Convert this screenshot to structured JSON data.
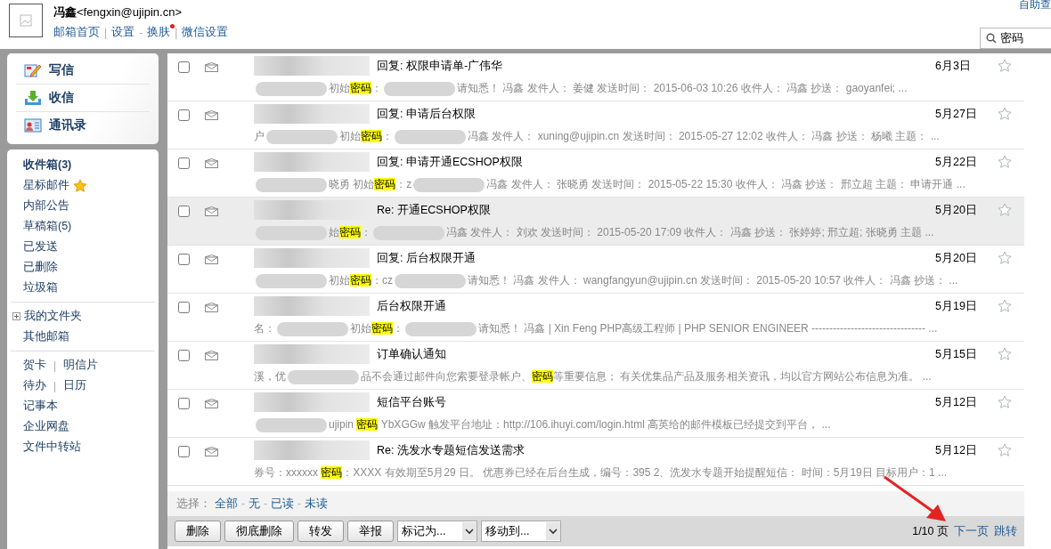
{
  "header": {
    "user": "**冯鑫**<fengxin@ujipin.cn>",
    "links": [
      {
        "label": "邮箱首页",
        "badge": false
      },
      {
        "label": "设置",
        "badge": false
      },
      {
        "label": "换肤",
        "badge": true
      },
      {
        "label": "微信设置",
        "badge": false
      }
    ],
    "separators": [
      "|",
      "-",
      "|"
    ],
    "help": "自助查",
    "search": {
      "value": "密码"
    }
  },
  "sidebar": {
    "actions": [
      {
        "label": "写信",
        "kind": "compose"
      },
      {
        "label": "收信",
        "kind": "receive"
      },
      {
        "label": "通讯录",
        "kind": "contacts"
      }
    ],
    "folders": [
      {
        "label": "收件箱(3)",
        "bold": true,
        "starred": false
      },
      {
        "label": "星标邮件",
        "bold": false,
        "starred": true
      },
      {
        "label": "内部公告",
        "bold": false,
        "starred": false
      },
      {
        "label": "草稿箱(5)",
        "bold": false,
        "starred": false
      },
      {
        "label": "已发送",
        "bold": false,
        "starred": false
      },
      {
        "label": "已删除",
        "bold": false,
        "starred": false
      },
      {
        "label": "垃圾箱",
        "bold": false,
        "starred": false
      }
    ],
    "my_folders": {
      "label": "我的文件夹",
      "expanded": false
    },
    "other": "其他邮箱",
    "tools": [
      {
        "items": [
          "贺卡",
          "明信片"
        ],
        "separator": "|"
      },
      {
        "items": [
          "待办",
          "日历"
        ],
        "separator": "|"
      },
      {
        "items": [
          "记事本"
        ]
      },
      {
        "items": [
          "企业网盘"
        ]
      },
      {
        "items": [
          "文件中转站"
        ]
      }
    ]
  },
  "messages": [
    {
      "subject": "回复: 权限申请单-广伟华",
      "date": "6月3日",
      "checked": false,
      "starred": false,
      "selected": false,
      "preview": [
        {
          "kind": "redacted"
        },
        {
          "kind": "text",
          "text": "初始"
        },
        {
          "kind": "highlight",
          "text": "密码"
        },
        {
          "kind": "text",
          "text": "："
        },
        {
          "kind": "redacted"
        },
        {
          "kind": "text",
          "text": "请知悉！ 冯鑫 发件人： 姜健 发送时间： 2015-06-03 10:26 收件人： 冯鑫 抄送： gaoyanfei; ..."
        }
      ]
    },
    {
      "subject": "回复: 申请后台权限",
      "date": "5月27日",
      "checked": false,
      "starred": false,
      "selected": false,
      "preview": [
        {
          "kind": "text",
          "text": "户"
        },
        {
          "kind": "redacted"
        },
        {
          "kind": "text",
          "text": "初始"
        },
        {
          "kind": "highlight",
          "text": "密码"
        },
        {
          "kind": "text",
          "text": "："
        },
        {
          "kind": "redacted"
        },
        {
          "kind": "text",
          "text": "冯鑫 发件人： xuning@ujipin.cn 发送时间： 2015-05-27 12:02 收件人： 冯鑫 抄送： 杨曦 主题： ..."
        }
      ]
    },
    {
      "subject": "回复: 申请开通ECSHOP权限",
      "date": "5月22日",
      "checked": false,
      "starred": false,
      "selected": false,
      "preview": [
        {
          "kind": "redacted"
        },
        {
          "kind": "text",
          "text": "晓勇 初始"
        },
        {
          "kind": "highlight",
          "text": "密码"
        },
        {
          "kind": "text",
          "text": "：z"
        },
        {
          "kind": "redacted"
        },
        {
          "kind": "text",
          "text": "冯鑫 发件人： 张晓勇 发送时间： 2015-05-22 15:30 收件人： 冯鑫 抄送： 邢立超 主题： 申请开通 ..."
        }
      ]
    },
    {
      "subject": "Re: 开通ECSHOP权限",
      "date": "5月20日",
      "checked": false,
      "starred": false,
      "selected": true,
      "preview": [
        {
          "kind": "redacted"
        },
        {
          "kind": "text",
          "text": "始"
        },
        {
          "kind": "highlight",
          "text": "密码"
        },
        {
          "kind": "text",
          "text": "："
        },
        {
          "kind": "redacted"
        },
        {
          "kind": "text",
          "text": "冯鑫 发件人： 刘欢 发送时间： 2015-05-20 17:09 收件人： 冯鑫 抄送： 张婷婷; 邢立超; 张晓勇 主题 ..."
        }
      ]
    },
    {
      "subject": "回复: 后台权限开通",
      "date": "5月20日",
      "checked": false,
      "starred": false,
      "selected": false,
      "preview": [
        {
          "kind": "redacted"
        },
        {
          "kind": "text",
          "text": "初始"
        },
        {
          "kind": "highlight",
          "text": "密码"
        },
        {
          "kind": "text",
          "text": "：cz"
        },
        {
          "kind": "redacted"
        },
        {
          "kind": "text",
          "text": "请知悉！ 冯鑫 发件人： wangfangyun@ujipin.cn 发送时间： 2015-05-20 10:57 收件人： 冯鑫 抄送： ..."
        }
      ]
    },
    {
      "subject": "后台权限开通",
      "date": "5月19日",
      "checked": false,
      "starred": false,
      "selected": false,
      "preview": [
        {
          "kind": "text",
          "text": "名："
        },
        {
          "kind": "redacted"
        },
        {
          "kind": "text",
          "text": "初始"
        },
        {
          "kind": "highlight",
          "text": "密码"
        },
        {
          "kind": "text",
          "text": "："
        },
        {
          "kind": "redacted"
        },
        {
          "kind": "text",
          "text": "请知悉！ 冯鑫 | Xin Feng PHP高级工程师 | PHP SENIOR ENGINEER -------------------------------- ..."
        }
      ]
    },
    {
      "subject": "订单确认通知",
      "date": "5月15日",
      "checked": false,
      "starred": false,
      "selected": false,
      "preview": [
        {
          "kind": "text",
          "text": "溪，优"
        },
        {
          "kind": "redacted"
        },
        {
          "kind": "text",
          "text": "品不会通过邮件向您索要登录帐户、"
        },
        {
          "kind": "highlight",
          "text": "密码"
        },
        {
          "kind": "text",
          "text": "等重要信息； 有关优集品产品及服务相关资讯，均以官方网站公布信息为准。 ..."
        }
      ]
    },
    {
      "subject": "短信平台账号",
      "date": "5月12日",
      "checked": false,
      "starred": false,
      "selected": false,
      "preview": [
        {
          "kind": "redacted"
        },
        {
          "kind": "text",
          "text": "ujipin "
        },
        {
          "kind": "highlight",
          "text": "密码"
        },
        {
          "kind": "text",
          "text": " YbXGGw 触发平台地址：http://106.ihuyi.com/login.html 高英给的邮件模板已经提交到平台， ..."
        }
      ]
    },
    {
      "subject": "Re: 洗发水专题短信发送需求",
      "date": "5月12日",
      "checked": false,
      "starred": false,
      "selected": false,
      "preview": [
        {
          "kind": "text",
          "text": "券号：xxxxxx "
        },
        {
          "kind": "highlight",
          "text": "密码"
        },
        {
          "kind": "text",
          "text": "：XXXX 有效期至5月29 日。 优惠券已经在后台生成，编号：395 2、洗发水专题开始提醒短信： 时间：5月19日 目标用户：1 ..."
        }
      ]
    }
  ],
  "select": {
    "label": "选择：",
    "options": [
      "全部",
      "无",
      "已读",
      "未读"
    ],
    "separator": "-"
  },
  "toolbar": {
    "buttons": [
      "删除",
      "彻底删除",
      "转发",
      "举报"
    ],
    "dropdowns": [
      "标记为...",
      "移动到..."
    ]
  },
  "pagination": {
    "pages": "1/10 页",
    "next": "下一页",
    "jump": "跳转"
  }
}
